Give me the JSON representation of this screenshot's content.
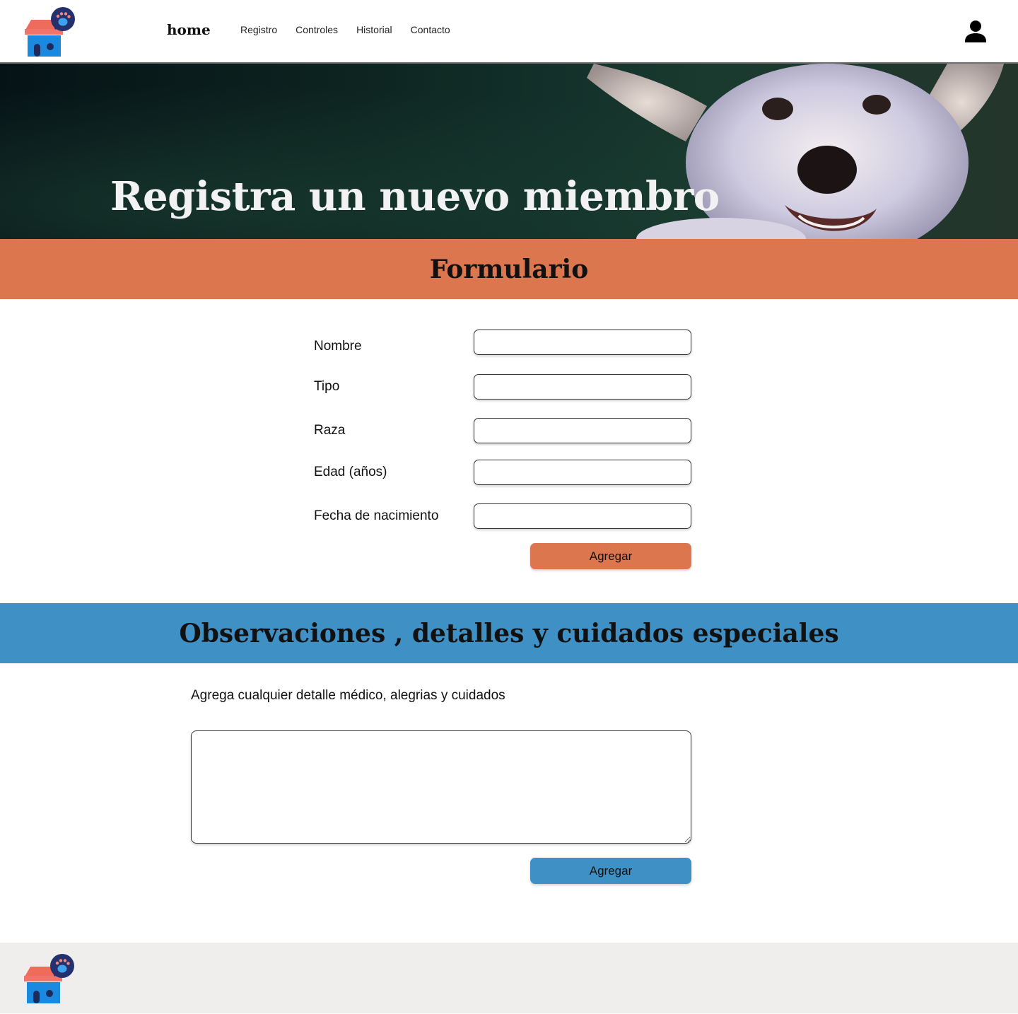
{
  "header": {
    "home_label": "home",
    "nav": [
      "Registro",
      "Controles",
      "Historial",
      "Contacto"
    ]
  },
  "hero": {
    "title": "Registra un nuevo miembro"
  },
  "form_section": {
    "title": "Formulario",
    "fields": [
      "Nombre",
      "Tipo",
      "Raza",
      "Edad (años)",
      "Fecha de nacimiento"
    ],
    "submit_label": "Agregar"
  },
  "observations_section": {
    "title": "Observaciones , detalles y cuidados especiales",
    "description": "Agrega cualquier detalle médico, alegrias y cuidados",
    "submit_label": "Agregar"
  },
  "colors": {
    "orange": "#db764f",
    "blue": "#3e90c5",
    "footer_bg": "#f0eeec",
    "logo_roof": "#ef6b5b",
    "logo_house": "#1a8ae0",
    "logo_bubble": "#25306e"
  },
  "icons": {
    "logo": "pet-shop-house-icon",
    "user": "user-icon"
  }
}
